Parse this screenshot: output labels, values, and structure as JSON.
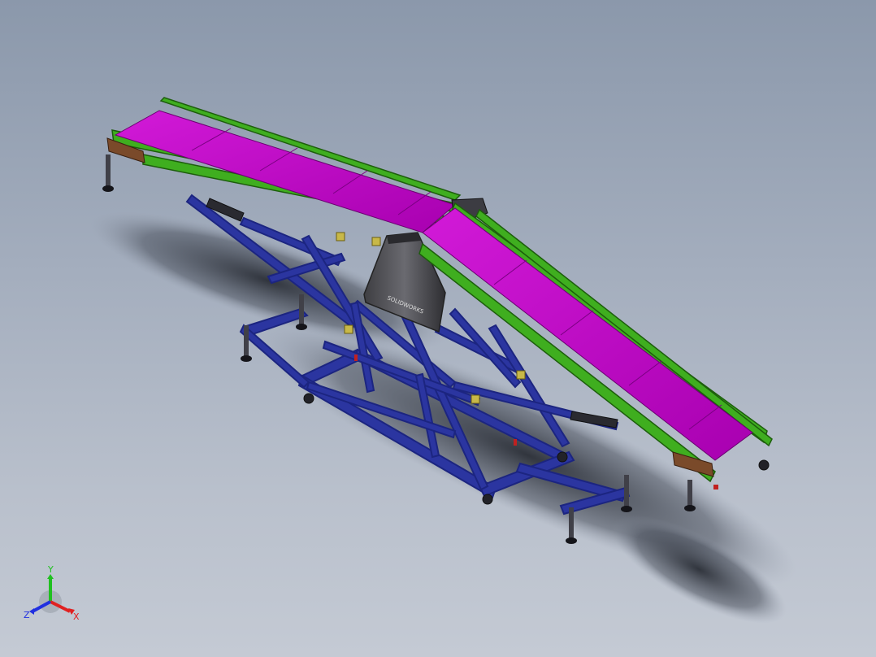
{
  "viewport": {
    "background_top": "#8b98ab",
    "background_bottom": "#c4cad4"
  },
  "model": {
    "belt_color": "#c300c9",
    "belt_frame_color": "#3fae1f",
    "support_frame_color": "#2b35a0",
    "housing_color": "#555555",
    "clamp_color": "#c8b848",
    "base_plate_label": "SOLIDWORKS"
  },
  "triad": {
    "x_label": "X",
    "y_label": "Y",
    "z_label": "Z",
    "x_color": "#e02020",
    "y_color": "#20c020",
    "z_color": "#2030e0"
  }
}
